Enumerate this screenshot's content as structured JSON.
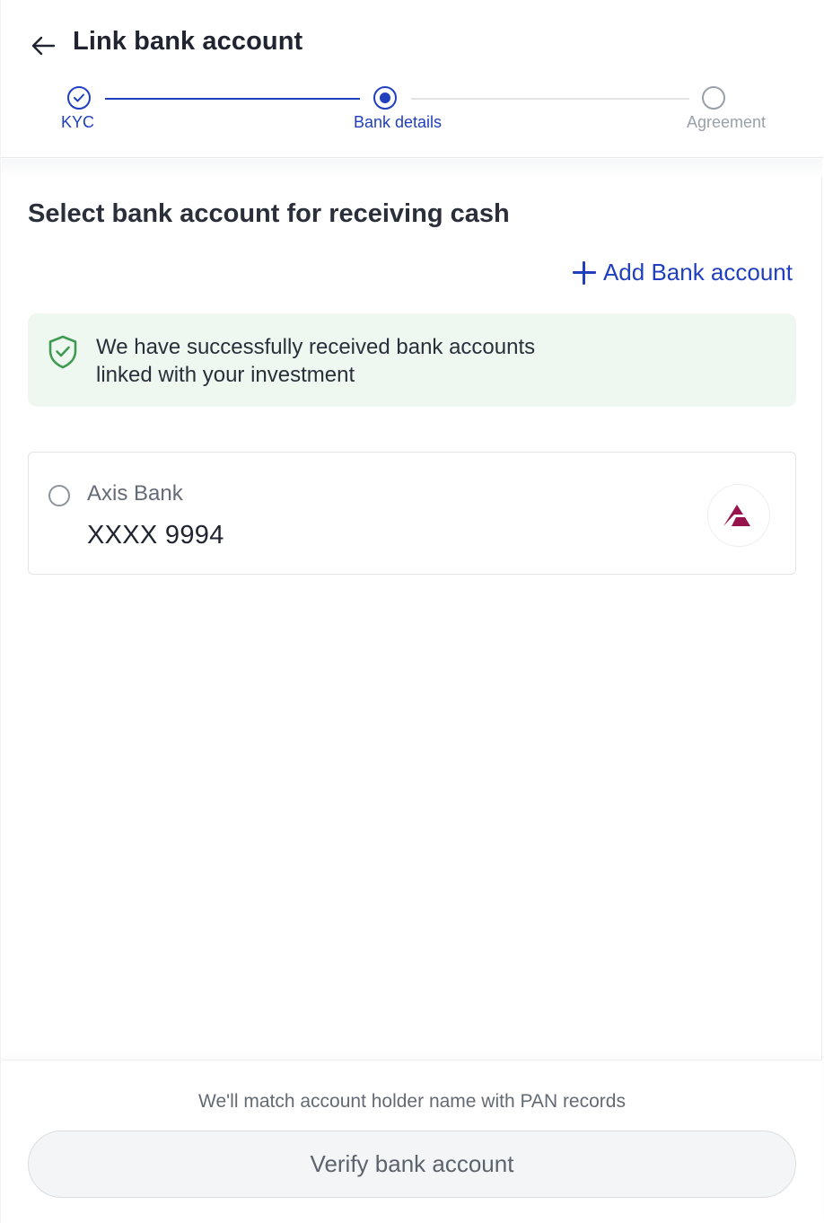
{
  "header": {
    "title": "Link bank account",
    "back_icon": "arrow-left-icon"
  },
  "stepper": {
    "steps": [
      {
        "label": "KYC",
        "state": "completed"
      },
      {
        "label": "Bank details",
        "state": "current"
      },
      {
        "label": "Agreement",
        "state": "pending"
      }
    ],
    "colors": {
      "active": "#1f3fbf",
      "inactive": "#9aa0aa"
    }
  },
  "main": {
    "section_title": "Select bank account for receiving cash",
    "add_bank_label": "Add Bank account",
    "info": {
      "icon": "shield-check-icon",
      "text": "We have successfully received bank accounts linked with your investment",
      "line1": "We have successfully received bank accounts",
      "line2": "linked with your investment",
      "background": "#eff7f1",
      "icon_color": "#3f9a52"
    },
    "accounts": [
      {
        "bank_name": "Axis Bank",
        "account_number": "XXXX 9994",
        "selected": false,
        "logo": "axis-bank-logo",
        "logo_color": "#97144d"
      }
    ]
  },
  "footer": {
    "note": "We'll match account holder name with PAN records",
    "verify_label": "Verify bank account"
  }
}
